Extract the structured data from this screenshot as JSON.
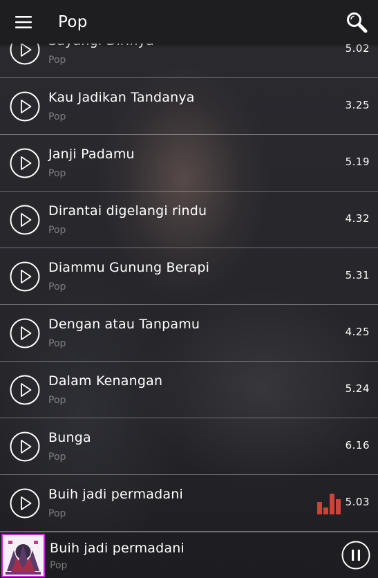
{
  "appbar": {
    "title": "Pop",
    "menu_icon": "hamburger-menu-icon",
    "search_icon": "search-icon"
  },
  "songs": [
    {
      "title": "Sayangi Dirinya",
      "genre": "Pop",
      "duration": "5.02",
      "playing": false
    },
    {
      "title": "Kau Jadikan Tandanya",
      "genre": "Pop",
      "duration": "3.25",
      "playing": false
    },
    {
      "title": "Janji Padamu",
      "genre": "Pop",
      "duration": "5.19",
      "playing": false
    },
    {
      "title": "Dirantai digelangi rindu",
      "genre": "Pop",
      "duration": "4.32",
      "playing": false
    },
    {
      "title": "Diammu Gunung Berapi",
      "genre": "Pop",
      "duration": "5.31",
      "playing": false
    },
    {
      "title": "Dengan atau Tanpamu",
      "genre": "Pop",
      "duration": "4.25",
      "playing": false
    },
    {
      "title": "Dalam Kenangan",
      "genre": "Pop",
      "duration": "5.24",
      "playing": false
    },
    {
      "title": "Bunga",
      "genre": "Pop",
      "duration": "6.16",
      "playing": false
    },
    {
      "title": "Buih jadi permadani",
      "genre": "Pop",
      "duration": "5.03",
      "playing": true
    }
  ],
  "now_playing": {
    "title": "Buih jadi permadani",
    "genre": "Pop",
    "cover_icon": "album-art-thumbnail",
    "control_icon": "pause-icon"
  },
  "colors": {
    "equalizer": "#d0413a",
    "cover_border": "#c42ad0",
    "appbar_bg": "#1c1c20"
  }
}
